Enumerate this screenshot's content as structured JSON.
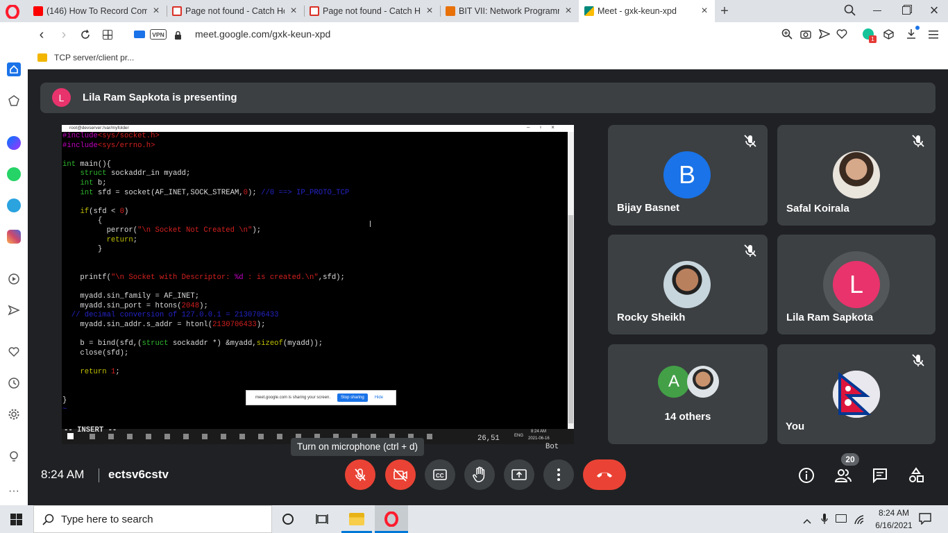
{
  "tabs": [
    {
      "title": "(146) How To Record Comp",
      "favicon_color": "#ff0000"
    },
    {
      "title": "Page not found - Catch Ho",
      "favicon_color": "#d93025"
    },
    {
      "title": "Page not found - Catch Ho",
      "favicon_color": "#d93025"
    },
    {
      "title": "BIT VII: Network Programm",
      "favicon_color": "#e8710a"
    },
    {
      "title": "Meet - gxk-keun-xpd",
      "favicon_color": "#00897b"
    }
  ],
  "address": {
    "vpn_label": "VPN",
    "url": "meet.google.com/gxk-keun-xpd",
    "extension_badge": "1"
  },
  "bookmarks": [
    {
      "label": "TCP server/client pr..."
    }
  ],
  "meet": {
    "presenting_initial": "L",
    "presenting_text": "Lila Ram Sapkota is presenting",
    "participants": [
      {
        "name": "Bijay Basnet",
        "initial": "B",
        "color": "#1a73e8"
      },
      {
        "name": "Safal Koirala"
      },
      {
        "name": "Rocky Sheikh"
      },
      {
        "name": "Lila Ram Sapkota",
        "initial": "L",
        "color": "#e8336d"
      },
      {
        "name": "14 others",
        "initial": "A",
        "color": "#43a047"
      },
      {
        "name": "You"
      }
    ],
    "time": "8:24 AM",
    "meeting_code": "ectsv6cstv",
    "tooltip": "Turn on microphone (ctrl + d)",
    "participant_count": "20",
    "colors": {
      "end_call": "#ea4335",
      "muted_btn": "#ea4335",
      "tile": "#3c4043",
      "bg": "#202124"
    }
  },
  "screen": {
    "window_title": "root@devserver:/var/myfolder",
    "code_lines": [
      [
        {
          "t": "#include",
          "c": "pp"
        },
        {
          "t": "<sys/socket.h>",
          "c": "rd"
        }
      ],
      [
        {
          "t": "#include",
          "c": "pp"
        },
        {
          "t": "<sys/errno.h>",
          "c": "rd"
        }
      ],
      [],
      [
        {
          "t": "int",
          "c": "gr"
        },
        {
          "t": " main(){"
        }
      ],
      [
        {
          "t": "    "
        },
        {
          "t": "struct",
          "c": "gr"
        },
        {
          "t": " sockaddr_in myadd;"
        }
      ],
      [
        {
          "t": "    "
        },
        {
          "t": "int",
          "c": "gr"
        },
        {
          "t": " b;"
        }
      ],
      [
        {
          "t": "    "
        },
        {
          "t": "int",
          "c": "gr"
        },
        {
          "t": " sfd = socket(AF_INET,SOCK_STREAM,"
        },
        {
          "t": "0",
          "c": "rd"
        },
        {
          "t": "); "
        },
        {
          "t": "//0 ==> IP_PROTO_TCP",
          "c": "bl"
        }
      ],
      [],
      [
        {
          "t": "    "
        },
        {
          "t": "if",
          "c": "ye"
        },
        {
          "t": "(sfd < "
        },
        {
          "t": "0",
          "c": "rd"
        },
        {
          "t": ")"
        }
      ],
      [
        {
          "t": "        {"
        }
      ],
      [
        {
          "t": "          perror("
        },
        {
          "t": "\"\\n Socket Not Created \\n\"",
          "c": "rd"
        },
        {
          "t": ");"
        }
      ],
      [
        {
          "t": "          "
        },
        {
          "t": "return",
          "c": "ye"
        },
        {
          "t": ";"
        }
      ],
      [
        {
          "t": "        }"
        }
      ],
      [],
      [],
      [
        {
          "t": "    printf("
        },
        {
          "t": "\"\\n Socket with Descriptor: ",
          "c": "rd"
        },
        {
          "t": "%d",
          "c": "pp"
        },
        {
          "t": " : is created.\\n\"",
          "c": "rd"
        },
        {
          "t": ",sfd);"
        }
      ],
      [],
      [
        {
          "t": "    myadd.sin_family = AF_INET;"
        }
      ],
      [
        {
          "t": "    myadd.sin_port = htons("
        },
        {
          "t": "2048",
          "c": "rd"
        },
        {
          "t": ");"
        }
      ],
      [
        {
          "t": "  "
        },
        {
          "t": "// decimal conversion of 127.0.0.1 = 2130706433",
          "c": "bl"
        }
      ],
      [
        {
          "t": "    myadd.sin_addr.s_addr = htonl("
        },
        {
          "t": "2130706433",
          "c": "rd"
        },
        {
          "t": ");"
        }
      ],
      [],
      [
        {
          "t": "    b = bind(sfd,("
        },
        {
          "t": "struct",
          "c": "gr"
        },
        {
          "t": " sockaddr *) &myadd,"
        },
        {
          "t": "sizeof",
          "c": "ye"
        },
        {
          "t": "(myadd));"
        }
      ],
      [
        {
          "t": "    close(sfd);"
        }
      ],
      [],
      [
        {
          "t": "    "
        },
        {
          "t": "return",
          "c": "ye"
        },
        {
          "t": " "
        },
        {
          "t": "1",
          "c": "rd"
        },
        {
          "t": ";"
        }
      ],
      [],
      [],
      [
        {
          "t": "}"
        }
      ],
      [
        {
          "t": "~",
          "c": "bl"
        }
      ]
    ],
    "status_mode": "-- INSERT --",
    "status_pos": "26,51",
    "status_scroll": "Bot",
    "share_notice": "meet.google.com is sharing your screen.",
    "stop_sharing": "Stop sharing",
    "hide": "Hide",
    "inner_lang": "ENG",
    "inner_time": "8:24 AM",
    "inner_date": "2021-06-16"
  },
  "taskbar": {
    "search_placeholder": "Type here to search",
    "time": "8:24 AM",
    "date": "6/16/2021"
  }
}
